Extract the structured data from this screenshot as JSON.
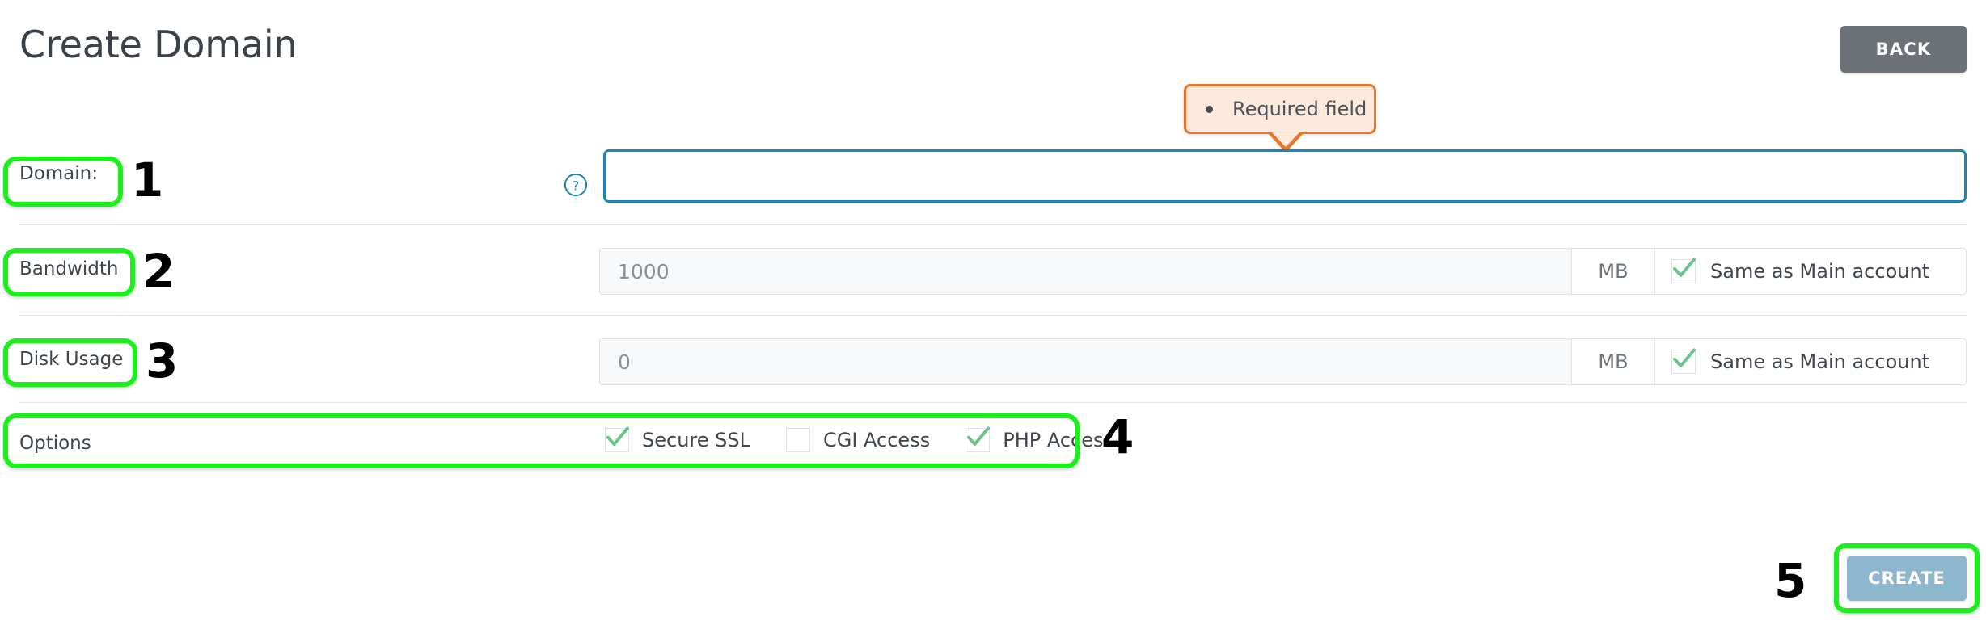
{
  "header": {
    "title": "Create Domain",
    "back_label": "BACK"
  },
  "tooltip": {
    "text": "Required field",
    "border_color": "#e8762c",
    "background_color": "#fdeadc"
  },
  "form": {
    "domain": {
      "label": "Domain:",
      "value": "",
      "placeholder": "",
      "help_icon": "question-circle-icon",
      "border_color": "#1d83b4"
    },
    "bandwidth": {
      "label": "Bandwidth",
      "value": "1000",
      "unit": "MB",
      "same_as_main": {
        "label": "Same as Main account",
        "checked": true
      }
    },
    "disk_usage": {
      "label": "Disk Usage",
      "value": "0",
      "unit": "MB",
      "same_as_main": {
        "label": "Same as Main account",
        "checked": true
      }
    },
    "options": {
      "label": "Options",
      "items": [
        {
          "label": "Secure SSL",
          "checked": true
        },
        {
          "label": "CGI Access",
          "checked": false
        },
        {
          "label": "PHP Access",
          "checked": true
        }
      ]
    }
  },
  "actions": {
    "create_label": "CREATE"
  },
  "annotations": {
    "markers": [
      "1",
      "2",
      "3",
      "4",
      "5"
    ],
    "highlight_color": "#1cf01c"
  },
  "colors": {
    "back_button": "#6d7278",
    "create_button": "#8cb7cd",
    "checkmark_green": "#6cc387"
  }
}
